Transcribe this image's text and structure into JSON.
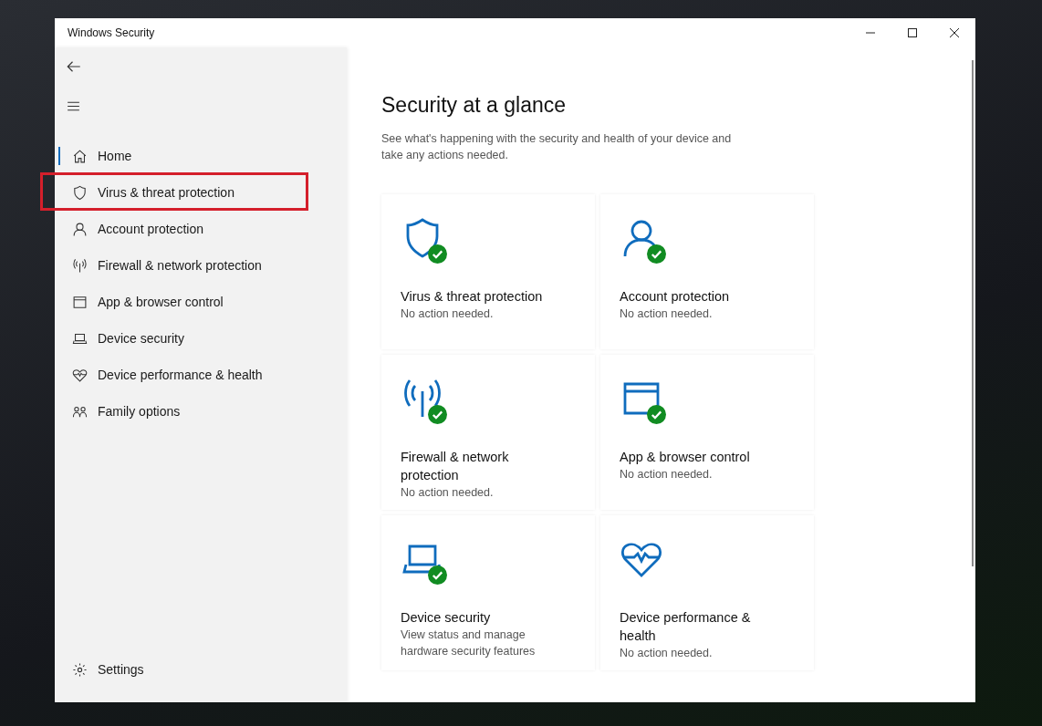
{
  "window": {
    "title": "Windows Security"
  },
  "sidebar": {
    "items": [
      {
        "kind": "home",
        "label": "Home",
        "selected": true,
        "highlighted": false
      },
      {
        "kind": "shield",
        "label": "Virus & threat protection",
        "selected": false,
        "highlighted": true
      },
      {
        "kind": "person",
        "label": "Account protection",
        "selected": false,
        "highlighted": false
      },
      {
        "kind": "antenna",
        "label": "Firewall & network protection",
        "selected": false,
        "highlighted": false
      },
      {
        "kind": "window",
        "label": "App & browser control",
        "selected": false,
        "highlighted": false
      },
      {
        "kind": "laptop",
        "label": "Device security",
        "selected": false,
        "highlighted": false
      },
      {
        "kind": "heart",
        "label": "Device performance & health",
        "selected": false,
        "highlighted": false
      },
      {
        "kind": "family",
        "label": "Family options",
        "selected": false,
        "highlighted": false
      }
    ],
    "settings": "Settings"
  },
  "main": {
    "heading": "Security at a glance",
    "subtitle": "See what's happening with the security and health of your device and take any actions needed.",
    "cards": [
      {
        "kind": "shield",
        "title": "Virus & threat protection",
        "status": "No action needed.",
        "ok": true
      },
      {
        "kind": "person",
        "title": "Account protection",
        "status": "No action needed.",
        "ok": true
      },
      {
        "kind": "antenna",
        "title": "Firewall & network protection",
        "status": "No action needed.",
        "ok": true
      },
      {
        "kind": "window",
        "title": "App & browser control",
        "status": "No action needed.",
        "ok": true
      },
      {
        "kind": "laptop",
        "title": "Device security",
        "status": "View status and manage hardware security features",
        "ok": true
      },
      {
        "kind": "heart",
        "title": "Device performance & health",
        "status": "No action needed.",
        "ok": false
      }
    ]
  }
}
